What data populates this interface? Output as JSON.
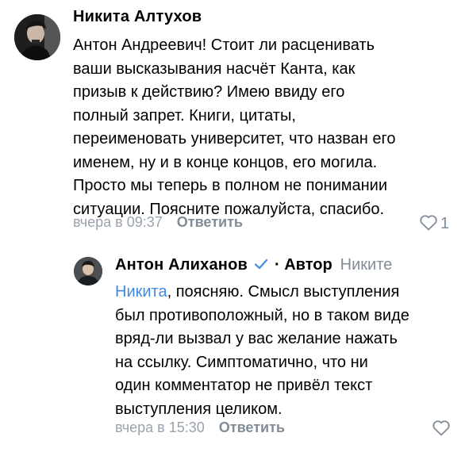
{
  "comments": [
    {
      "author": "Никита Алтухов",
      "text_lines": [
        "Антон Андреевич! Стоит ли расценивать",
        "ваши высказывания насчёт Канта, как",
        "призыв к действию? Имею ввиду его",
        "полный запрет. Книги, цитаты,",
        "переименовать университет, что назван его",
        "именем, ну и в конце концов, его могила.",
        "Просто мы теперь в полном не понимании",
        "ситуации. Поясните пожалуйста, спасибо."
      ],
      "time": "вчера в 09:37",
      "reply_label": "Ответить",
      "likes": "1"
    },
    {
      "author": "Антон Алиханов",
      "author_role": "· Автор",
      "reply_to": "Никите",
      "mention": "Никита",
      "text_first_rest": ", поясняю. Смысл выступления",
      "text_lines": [
        "был противоположный, но в таком виде",
        "вряд-ли вызвал у вас желание нажать",
        "на ссылку. Симптоматично, что ни",
        "один комментатор не привёл текст",
        "выступления целиком."
      ],
      "time": "вчера в 15:30",
      "reply_label": "Ответить"
    }
  ],
  "colors": {
    "secondary_text": "#818c99",
    "timestamp": "#99a2ad",
    "link": "#3f8ae0",
    "verified": "#4a8fe3"
  },
  "icons": {
    "like": "heart-outline-icon",
    "verified": "checkmark-icon"
  }
}
